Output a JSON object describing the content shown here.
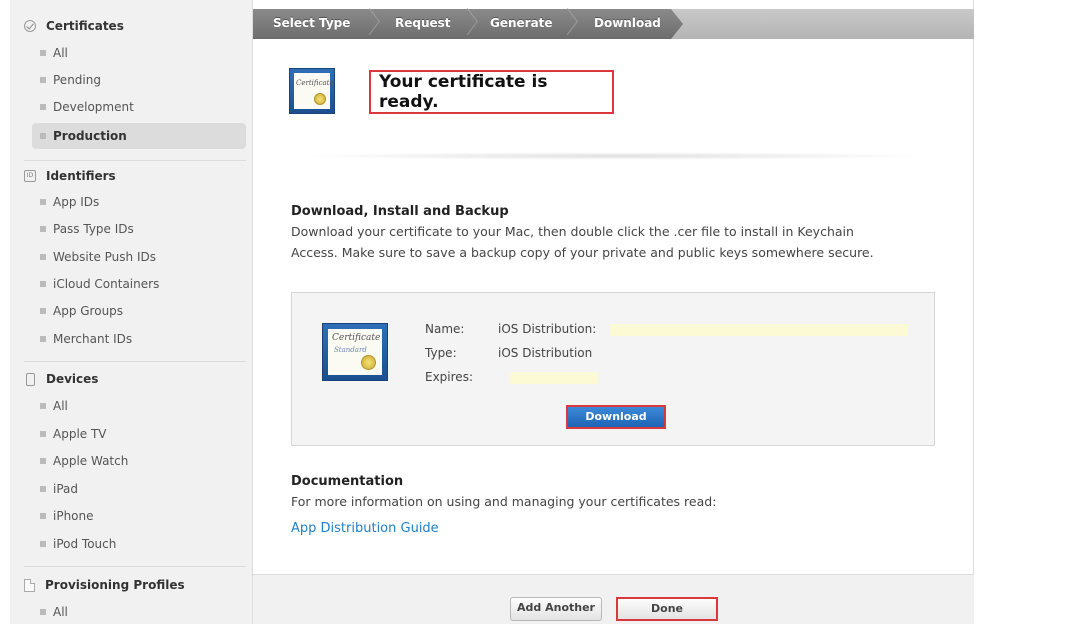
{
  "sidebar": {
    "sections": {
      "certificates": {
        "title": "Certificates",
        "items": [
          "All",
          "Pending",
          "Development",
          "Production"
        ]
      },
      "identifiers": {
        "title": "Identifiers",
        "icon_text": "ID",
        "items": [
          "App IDs",
          "Pass Type IDs",
          "Website Push IDs",
          "iCloud Containers",
          "App Groups",
          "Merchant IDs"
        ]
      },
      "devices": {
        "title": "Devices",
        "items": [
          "All",
          "Apple TV",
          "Apple Watch",
          "iPad",
          "iPhone",
          "iPod Touch"
        ]
      },
      "profiles": {
        "title": "Provisioning Profiles",
        "items": [
          "All"
        ]
      }
    },
    "active_item": "Production"
  },
  "steps": [
    "Select Type",
    "Request",
    "Generate",
    "Download"
  ],
  "header": {
    "title": "Your certificate is ready.",
    "icon_script": "Certificate"
  },
  "download_section": {
    "title": "Download, Install and Backup",
    "text_line1": "Download your certificate to your Mac, then double click the .cer file to install in Keychain",
    "text_line2": "Access. Make sure to save a backup copy of your private and public keys somewhere secure."
  },
  "certificate": {
    "icon_script": "Certificate",
    "icon_script2": "Standard",
    "name_label": "Name:",
    "name_value": "iOS Distribution:",
    "type_label": "Type:",
    "type_value": "iOS Distribution",
    "expires_label": "Expires:",
    "download_label": "Download"
  },
  "documentation": {
    "title": "Documentation",
    "text": "For more information on using and managing your certificates read:",
    "link": "App Distribution Guide"
  },
  "footer": {
    "add_another_label": "Add Another",
    "done_label": "Done"
  },
  "colors": {
    "highlight": "#d9383d",
    "link": "#1e7fc8",
    "primary_button": "#2a74c7"
  }
}
